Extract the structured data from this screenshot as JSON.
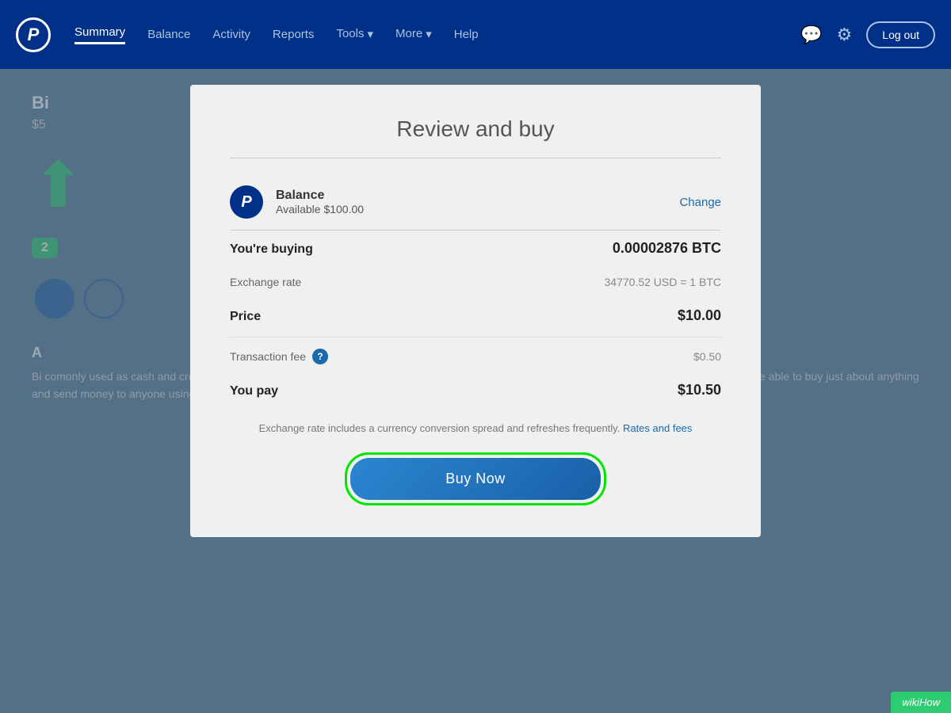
{
  "navbar": {
    "logo_text": "P",
    "links": [
      {
        "label": "Summary",
        "active": true
      },
      {
        "label": "Balance",
        "active": false
      },
      {
        "label": "Activity",
        "active": false
      },
      {
        "label": "Reports",
        "active": false
      },
      {
        "label": "Tools",
        "has_arrow": true,
        "active": false
      },
      {
        "label": "More",
        "has_arrow": true,
        "active": false
      },
      {
        "label": "Help",
        "active": false
      }
    ],
    "logout_label": "Log out",
    "message_icon": "💬",
    "settings_icon": "⚙"
  },
  "background": {
    "title_partial": "Bi",
    "subtitle_partial": "$5",
    "badge_text": "2",
    "section_title": "A",
    "body_text": "Bi comonly used as cash and credit. It set off a revolution that has since inspired thousands of variations on the original. Someday soon, you might be able to buy just about anything and send money to anyone using bitcoins and other"
  },
  "modal": {
    "title": "Review and buy",
    "payment_method": {
      "name": "Balance",
      "available": "Available $100.00",
      "change_label": "Change"
    },
    "buying_label": "You're buying",
    "buying_value": "0.00002876 BTC",
    "exchange_rate_label": "Exchange rate",
    "exchange_rate_value": "34770.52 USD = 1 BTC",
    "price_label": "Price",
    "price_value": "$10.00",
    "transaction_fee_label": "Transaction fee",
    "transaction_fee_value": "$0.50",
    "you_pay_label": "You pay",
    "you_pay_value": "$10.50",
    "footer_note_text": "Exchange rate includes a currency conversion spread and refreshes frequently.",
    "rates_fees_link": "Rates and fees",
    "buy_now_label": "Buy Now"
  },
  "wikihow": {
    "label": "wikiHow"
  }
}
